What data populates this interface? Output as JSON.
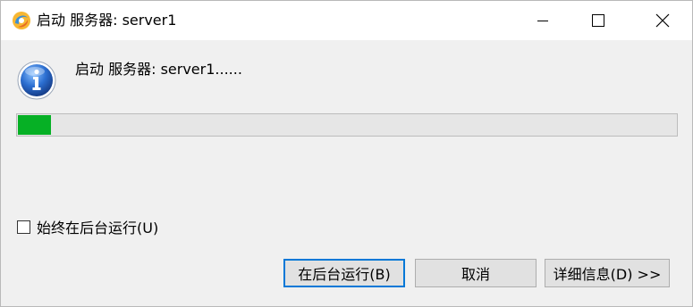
{
  "window": {
    "title": "启动 服务器: server1",
    "app_icon": "eclipse-swirl-icon",
    "controls": {
      "minimize_icon": "minimize-icon",
      "maximize_icon": "maximize-icon",
      "close_icon": "close-icon"
    }
  },
  "dialog": {
    "info_icon": "info-icon",
    "message": "启动 服务器: server1......",
    "progress": {
      "fraction": 0.05,
      "color": "#06b025"
    },
    "checkbox": {
      "label": "始终在后台运行(U)",
      "checked": false
    }
  },
  "buttons": {
    "run_in_background": "在后台运行(B)",
    "cancel": "取消",
    "details": "详细信息(D) >>"
  },
  "colors": {
    "progress_fill": "#06b025",
    "focus_border": "#0078d7",
    "button_bg": "#e1e1e1"
  }
}
